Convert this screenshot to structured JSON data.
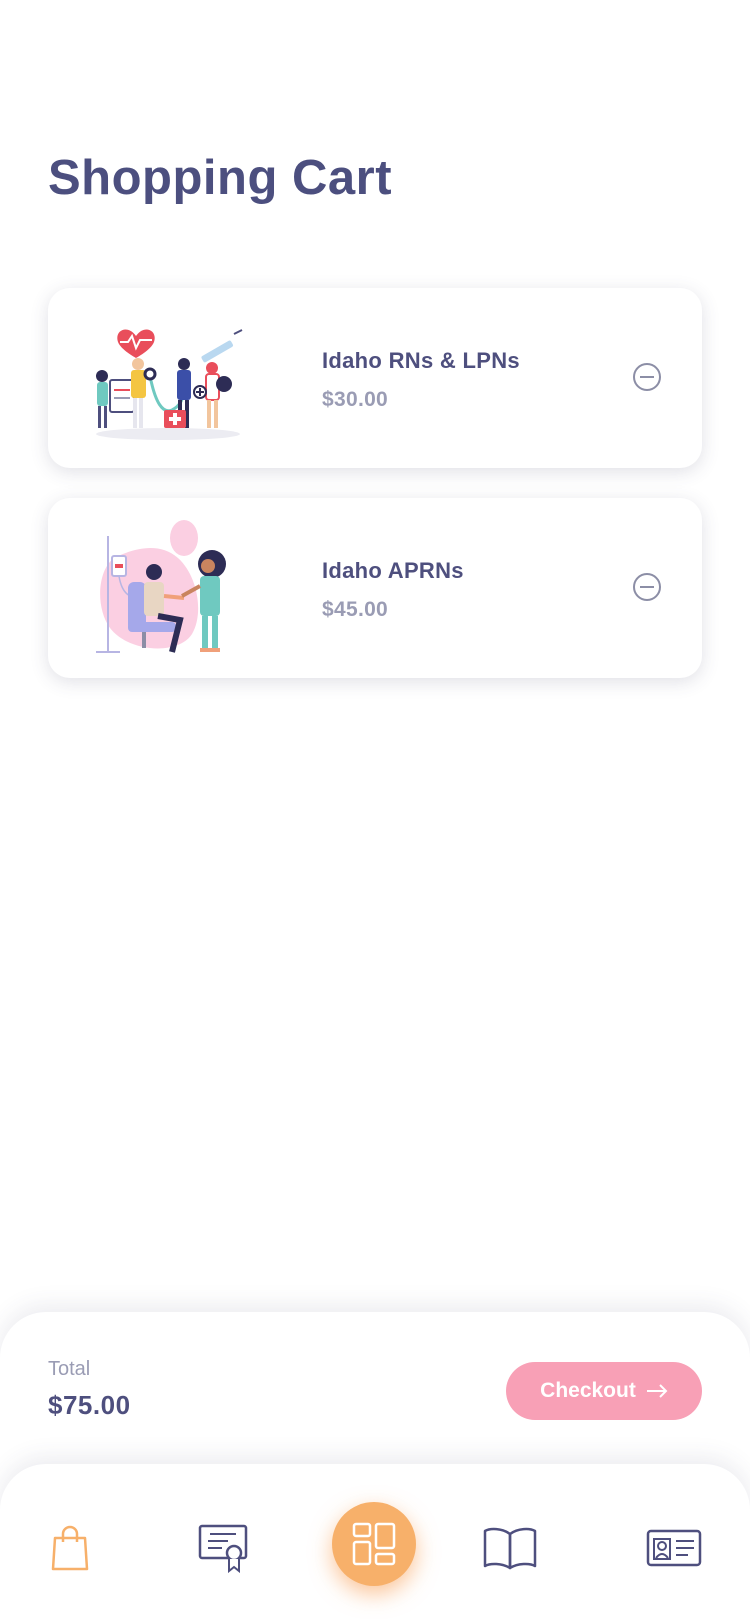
{
  "page": {
    "title": "Shopping Cart"
  },
  "cart": {
    "items": [
      {
        "name": "Idaho RNs & LPNs",
        "price": "$30.00",
        "illustration": "medical-team-illustration"
      },
      {
        "name": "Idaho APRNs",
        "price": "$45.00",
        "illustration": "nurse-patient-illustration"
      }
    ],
    "remove_icon": "minus-circle-icon"
  },
  "summary": {
    "total_label": "Total",
    "total_value": "$75.00",
    "checkout_label": "Checkout",
    "checkout_icon": "arrow-right-icon"
  },
  "nav": {
    "items": [
      {
        "icon": "shopping-bag-icon",
        "active": true
      },
      {
        "icon": "certificate-icon",
        "active": false
      },
      {
        "icon": "dashboard-grid-icon",
        "active": false
      },
      {
        "icon": "open-book-icon",
        "active": false
      },
      {
        "icon": "id-card-icon",
        "active": false
      }
    ]
  },
  "colors": {
    "heading": "#4c4f7f",
    "muted": "#9a9cb4",
    "checkout": "#f8a0b6",
    "accent_orange": "#f7b06a"
  }
}
